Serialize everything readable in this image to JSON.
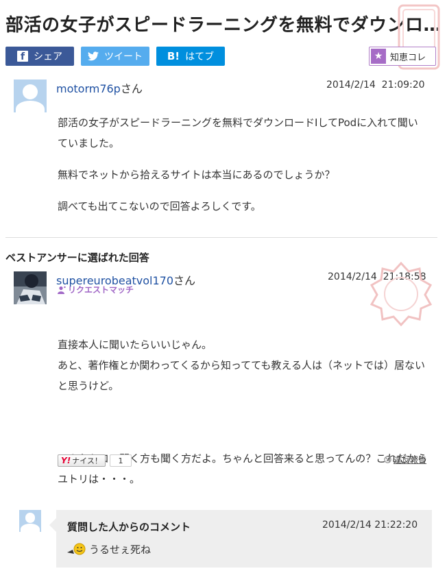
{
  "page": {
    "title": "部活の女子がスピードラーニングを無料でダウンロードしてPodに入れて聞いていました。無料でネットから拾えるサイトは本当にあるのでしょうか？"
  },
  "share": {
    "facebook": "シェア",
    "twitter": "ツイート",
    "hatena": "はてブ",
    "chie": "知恵コレ"
  },
  "question": {
    "user": "motorm76p",
    "honorific": "さん",
    "date": "2014/2/14  21:09:20",
    "paragraphs": [
      "部活の女子がスピードラーニングを無料でダウンロードIしてPodに入れて聞いていました。",
      "無料でネットから拾えるサイトは本当にあるのでしょうか？",
      "調べても出てこないので回答よろしくです。"
    ]
  },
  "best_answer": {
    "heading": "ベストアンサーに選ばれた回答",
    "user": "supereurobeatvol170",
    "honorific": "さん",
    "badge": "リクエストマッチ",
    "date": "2014/2/14  21:18:58",
    "paragraphs": [
      "直接本人に聞いたらいいじゃん。\nあと、著作権とか関わってくるから知ってても教える人は（ネットでは）居ないと思うけど。",
      "こんなトコで聞く方も聞く方だよ。ちゃんと回答来ると思ってんの？これだからユトリは・・・。"
    ],
    "nice_label": "ナイス！",
    "nice_logo": "Y!",
    "nice_count": "1",
    "report": "違反報告"
  },
  "comment": {
    "heading": "質問した人からのコメント",
    "date": "2014/2/14 21:22:20",
    "text": "うるせぇ死ね"
  },
  "colors": {
    "facebook": "#3b5998",
    "twitter": "#55acee",
    "hatena": "#008fde",
    "accent_purple": "#a66cc6",
    "link_blue": "#1e50a2"
  }
}
